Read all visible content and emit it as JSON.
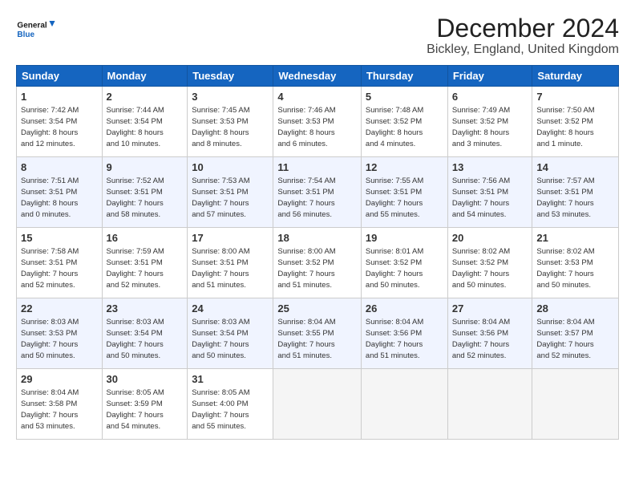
{
  "logo": {
    "line1": "General",
    "line2": "Blue"
  },
  "title": "December 2024",
  "subtitle": "Bickley, England, United Kingdom",
  "headers": [
    "Sunday",
    "Monday",
    "Tuesday",
    "Wednesday",
    "Thursday",
    "Friday",
    "Saturday"
  ],
  "weeks": [
    [
      {
        "day": "1",
        "info": "Sunrise: 7:42 AM\nSunset: 3:54 PM\nDaylight: 8 hours\nand 12 minutes."
      },
      {
        "day": "2",
        "info": "Sunrise: 7:44 AM\nSunset: 3:54 PM\nDaylight: 8 hours\nand 10 minutes."
      },
      {
        "day": "3",
        "info": "Sunrise: 7:45 AM\nSunset: 3:53 PM\nDaylight: 8 hours\nand 8 minutes."
      },
      {
        "day": "4",
        "info": "Sunrise: 7:46 AM\nSunset: 3:53 PM\nDaylight: 8 hours\nand 6 minutes."
      },
      {
        "day": "5",
        "info": "Sunrise: 7:48 AM\nSunset: 3:52 PM\nDaylight: 8 hours\nand 4 minutes."
      },
      {
        "day": "6",
        "info": "Sunrise: 7:49 AM\nSunset: 3:52 PM\nDaylight: 8 hours\nand 3 minutes."
      },
      {
        "day": "7",
        "info": "Sunrise: 7:50 AM\nSunset: 3:52 PM\nDaylight: 8 hours\nand 1 minute."
      }
    ],
    [
      {
        "day": "8",
        "info": "Sunrise: 7:51 AM\nSunset: 3:51 PM\nDaylight: 8 hours\nand 0 minutes."
      },
      {
        "day": "9",
        "info": "Sunrise: 7:52 AM\nSunset: 3:51 PM\nDaylight: 7 hours\nand 58 minutes."
      },
      {
        "day": "10",
        "info": "Sunrise: 7:53 AM\nSunset: 3:51 PM\nDaylight: 7 hours\nand 57 minutes."
      },
      {
        "day": "11",
        "info": "Sunrise: 7:54 AM\nSunset: 3:51 PM\nDaylight: 7 hours\nand 56 minutes."
      },
      {
        "day": "12",
        "info": "Sunrise: 7:55 AM\nSunset: 3:51 PM\nDaylight: 7 hours\nand 55 minutes."
      },
      {
        "day": "13",
        "info": "Sunrise: 7:56 AM\nSunset: 3:51 PM\nDaylight: 7 hours\nand 54 minutes."
      },
      {
        "day": "14",
        "info": "Sunrise: 7:57 AM\nSunset: 3:51 PM\nDaylight: 7 hours\nand 53 minutes."
      }
    ],
    [
      {
        "day": "15",
        "info": "Sunrise: 7:58 AM\nSunset: 3:51 PM\nDaylight: 7 hours\nand 52 minutes."
      },
      {
        "day": "16",
        "info": "Sunrise: 7:59 AM\nSunset: 3:51 PM\nDaylight: 7 hours\nand 52 minutes."
      },
      {
        "day": "17",
        "info": "Sunrise: 8:00 AM\nSunset: 3:51 PM\nDaylight: 7 hours\nand 51 minutes."
      },
      {
        "day": "18",
        "info": "Sunrise: 8:00 AM\nSunset: 3:52 PM\nDaylight: 7 hours\nand 51 minutes."
      },
      {
        "day": "19",
        "info": "Sunrise: 8:01 AM\nSunset: 3:52 PM\nDaylight: 7 hours\nand 50 minutes."
      },
      {
        "day": "20",
        "info": "Sunrise: 8:02 AM\nSunset: 3:52 PM\nDaylight: 7 hours\nand 50 minutes."
      },
      {
        "day": "21",
        "info": "Sunrise: 8:02 AM\nSunset: 3:53 PM\nDaylight: 7 hours\nand 50 minutes."
      }
    ],
    [
      {
        "day": "22",
        "info": "Sunrise: 8:03 AM\nSunset: 3:53 PM\nDaylight: 7 hours\nand 50 minutes."
      },
      {
        "day": "23",
        "info": "Sunrise: 8:03 AM\nSunset: 3:54 PM\nDaylight: 7 hours\nand 50 minutes."
      },
      {
        "day": "24",
        "info": "Sunrise: 8:03 AM\nSunset: 3:54 PM\nDaylight: 7 hours\nand 50 minutes."
      },
      {
        "day": "25",
        "info": "Sunrise: 8:04 AM\nSunset: 3:55 PM\nDaylight: 7 hours\nand 51 minutes."
      },
      {
        "day": "26",
        "info": "Sunrise: 8:04 AM\nSunset: 3:56 PM\nDaylight: 7 hours\nand 51 minutes."
      },
      {
        "day": "27",
        "info": "Sunrise: 8:04 AM\nSunset: 3:56 PM\nDaylight: 7 hours\nand 52 minutes."
      },
      {
        "day": "28",
        "info": "Sunrise: 8:04 AM\nSunset: 3:57 PM\nDaylight: 7 hours\nand 52 minutes."
      }
    ],
    [
      {
        "day": "29",
        "info": "Sunrise: 8:04 AM\nSunset: 3:58 PM\nDaylight: 7 hours\nand 53 minutes."
      },
      {
        "day": "30",
        "info": "Sunrise: 8:05 AM\nSunset: 3:59 PM\nDaylight: 7 hours\nand 54 minutes."
      },
      {
        "day": "31",
        "info": "Sunrise: 8:05 AM\nSunset: 4:00 PM\nDaylight: 7 hours\nand 55 minutes."
      },
      {
        "day": "",
        "info": ""
      },
      {
        "day": "",
        "info": ""
      },
      {
        "day": "",
        "info": ""
      },
      {
        "day": "",
        "info": ""
      }
    ]
  ]
}
